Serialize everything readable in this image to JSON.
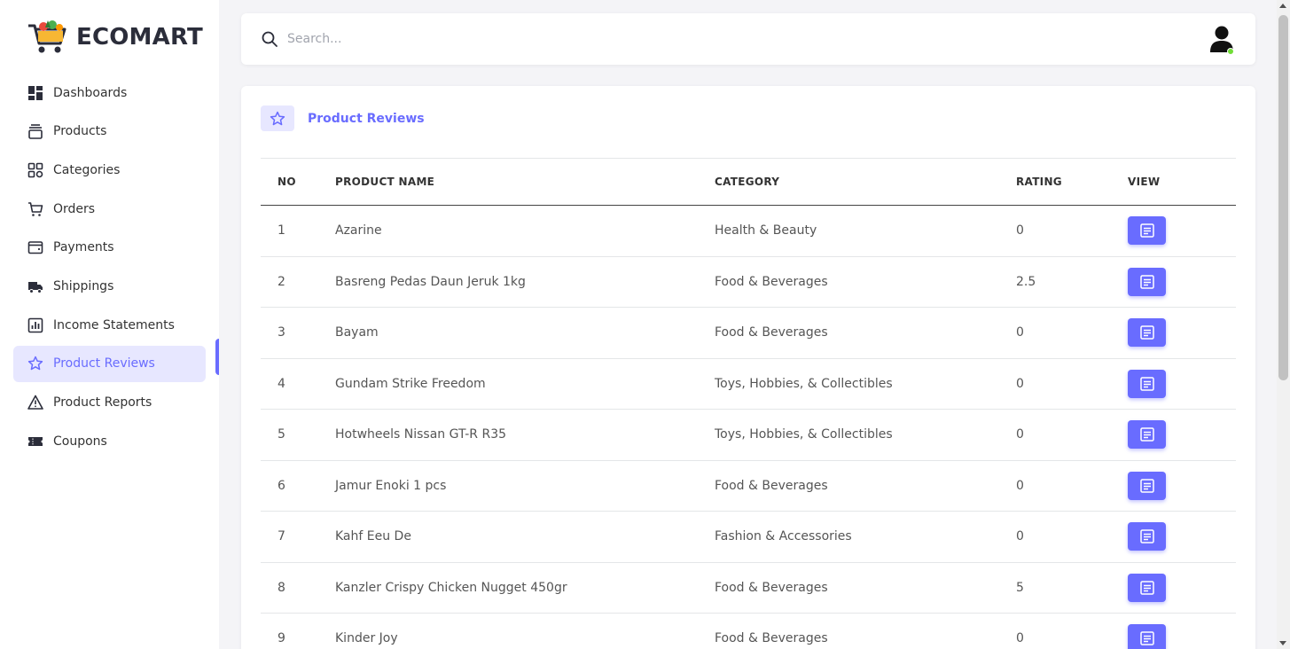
{
  "brand": {
    "name": "ECOMART"
  },
  "sidebar": {
    "items": [
      {
        "label": "Dashboards",
        "icon": "dashboard-icon"
      },
      {
        "label": "Products",
        "icon": "products-icon"
      },
      {
        "label": "Categories",
        "icon": "categories-icon"
      },
      {
        "label": "Orders",
        "icon": "cart-icon"
      },
      {
        "label": "Payments",
        "icon": "wallet-icon"
      },
      {
        "label": "Shippings",
        "icon": "truck-icon"
      },
      {
        "label": "Income Statements",
        "icon": "chart-icon"
      },
      {
        "label": "Product Reviews",
        "icon": "star-icon",
        "active": true
      },
      {
        "label": "Product Reports",
        "icon": "warning-icon"
      },
      {
        "label": "Coupons",
        "icon": "ticket-icon"
      }
    ]
  },
  "search": {
    "placeholder": "Search..."
  },
  "page": {
    "title": "Product Reviews",
    "icon": "star-icon"
  },
  "table": {
    "headers": [
      "NO",
      "PRODUCT NAME",
      "CATEGORY",
      "RATING",
      "VIEW"
    ],
    "rows": [
      {
        "no": "1",
        "name": "Azarine",
        "category": "Health & Beauty",
        "rating": "0"
      },
      {
        "no": "2",
        "name": "Basreng Pedas Daun Jeruk 1kg",
        "category": "Food & Beverages",
        "rating": "2.5"
      },
      {
        "no": "3",
        "name": "Bayam",
        "category": "Food & Beverages",
        "rating": "0"
      },
      {
        "no": "4",
        "name": "Gundam Strike Freedom",
        "category": "Toys, Hobbies, & Collectibles",
        "rating": "0"
      },
      {
        "no": "5",
        "name": "Hotwheels Nissan GT-R R35",
        "category": "Toys, Hobbies, & Collectibles",
        "rating": "0"
      },
      {
        "no": "6",
        "name": "Jamur Enoki 1 pcs",
        "category": "Food & Beverages",
        "rating": "0"
      },
      {
        "no": "7",
        "name": "Kahf Eeu De",
        "category": "Fashion & Accessories",
        "rating": "0"
      },
      {
        "no": "8",
        "name": "Kanzler Crispy Chicken Nugget 450gr",
        "category": "Food & Beverages",
        "rating": "5"
      },
      {
        "no": "9",
        "name": "Kinder Joy",
        "category": "Food & Beverages",
        "rating": "0"
      }
    ]
  },
  "colors": {
    "accent": "#696cff",
    "accent_light": "#e7e7ff",
    "online": "#71dd37"
  }
}
